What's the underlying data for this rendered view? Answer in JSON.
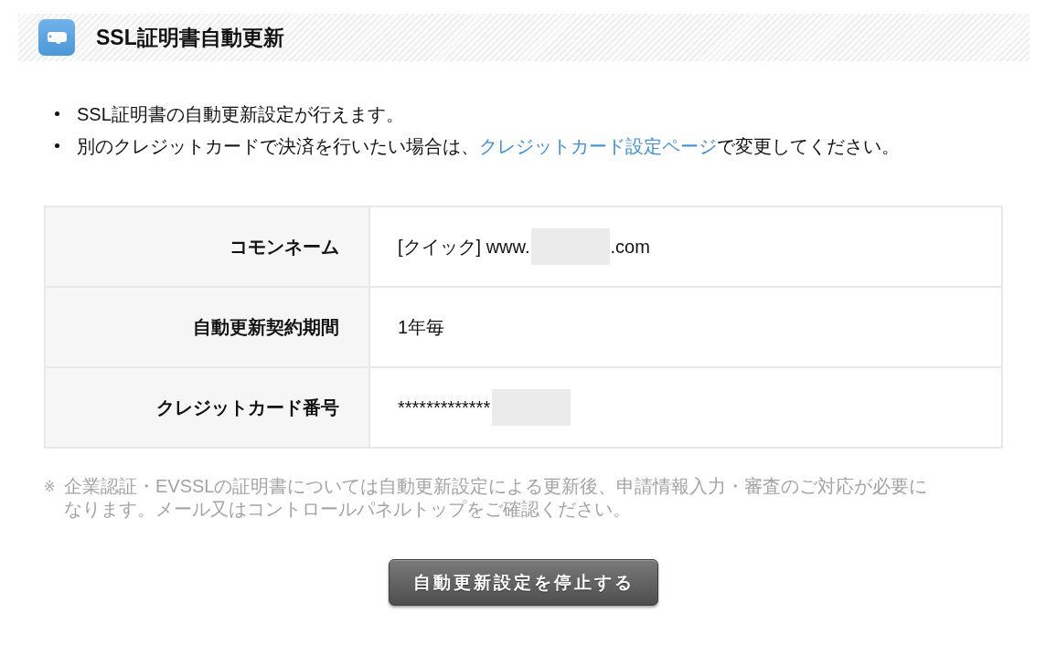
{
  "header": {
    "title": "SSL証明書自動更新"
  },
  "bullets": [
    {
      "parts": [
        {
          "kind": "text",
          "text": "SSL証明書の自動更新設定が行えます。"
        }
      ]
    },
    {
      "parts": [
        {
          "kind": "text",
          "text": "別のクレジットカードで決済を行いたい場合は、"
        },
        {
          "kind": "link",
          "text": "クレジットカード設定ページ"
        },
        {
          "kind": "text",
          "text": "で変更してください。"
        }
      ]
    }
  ],
  "table": {
    "rows": [
      {
        "label": "コモンネーム",
        "value": [
          {
            "kind": "text",
            "text": "[クイック] www."
          },
          {
            "kind": "redacted"
          },
          {
            "kind": "text",
            "text": ".com"
          }
        ]
      },
      {
        "label": "自動更新契約期間",
        "value": [
          {
            "kind": "text",
            "text": "1年毎"
          }
        ]
      },
      {
        "label": "クレジットカード番号",
        "value": [
          {
            "kind": "text",
            "text": "*************"
          },
          {
            "kind": "redacted"
          }
        ]
      }
    ]
  },
  "note": {
    "mark": "※",
    "text": "企業認証・EVSSLの証明書については自動更新設定による更新後、申請情報入力・審査のご対応が必要になります。メール又はコントロールパネルトップをご確認ください。"
  },
  "button": {
    "label": "自動更新設定を停止する"
  }
}
